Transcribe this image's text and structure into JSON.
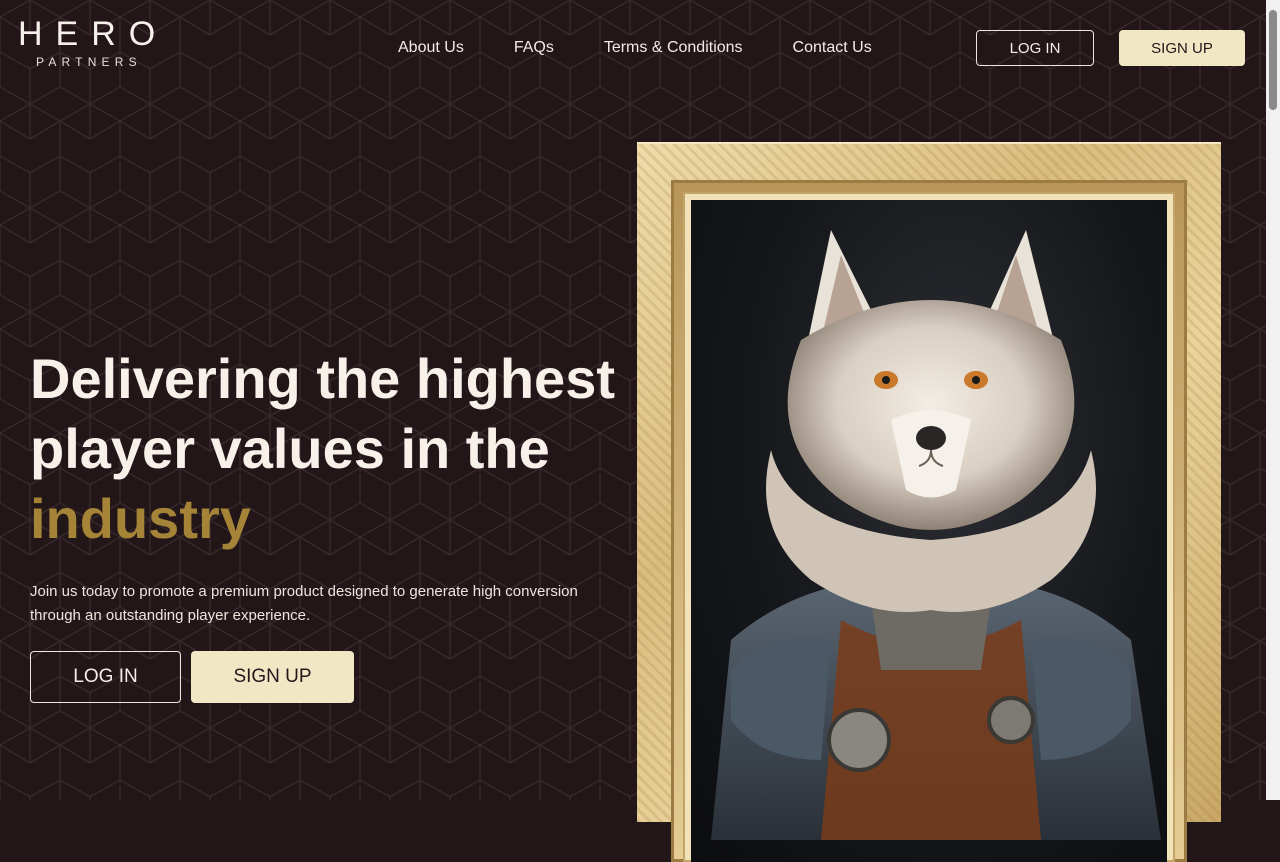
{
  "brand": {
    "name": "HERO",
    "tagline": "PARTNERS"
  },
  "nav": {
    "items": [
      "About Us",
      "FAQs",
      "Terms & Conditions",
      "Contact Us"
    ]
  },
  "header_buttons": {
    "login": "LOG IN",
    "signup": "SIGN UP"
  },
  "hero": {
    "title_line1": "Delivering the highest",
    "title_line2": "player values in the",
    "title_accent": "industry",
    "subtitle": "Join us today to promote a premium product designed to generate high conversion through an outstanding player experience.",
    "login": "LOG IN",
    "signup": "SIGN UP"
  },
  "image": {
    "subject": "fox-in-armor-portrait"
  },
  "colors": {
    "background": "#221619",
    "accent_gold": "#a58337",
    "button_cream": "#f1e7c5",
    "text_light": "#f3ece6"
  }
}
